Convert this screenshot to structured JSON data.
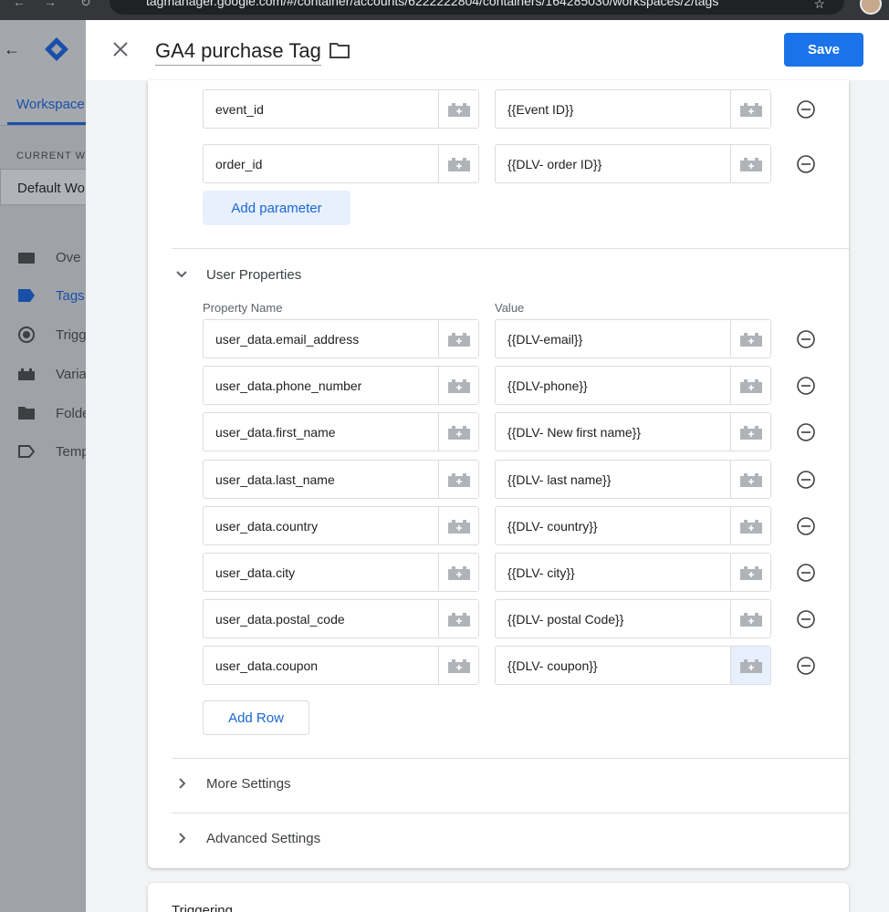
{
  "browser": {
    "url": "tagmanager.google.com/#/container/accounts/6222222804/containers/164285030/workspaces/2/tags"
  },
  "background": {
    "tab_label": "Workspace",
    "current_label": "CURRENT WO",
    "workspace_name": "Default Wo",
    "nav": [
      "Ove",
      "Tags",
      "Trigg",
      "Varia",
      "Folde",
      "Temp"
    ]
  },
  "panel": {
    "title": "GA4 purchase Tag",
    "save_label": "Save"
  },
  "event_params": [
    {
      "name": "event_id",
      "value": "{{Event ID}}"
    },
    {
      "name": "order_id",
      "value": "{{DLV- order ID}}"
    }
  ],
  "add_parameter_label": "Add parameter",
  "user_properties": {
    "title": "User Properties",
    "col_name": "Property Name",
    "col_value": "Value",
    "rows": [
      {
        "name": "user_data.email_address",
        "value": "{{DLV-email}}"
      },
      {
        "name": "user_data.phone_number",
        "value": "{{DLV-phone}}"
      },
      {
        "name": "user_data.first_name",
        "value": "{{DLV- New first name}}"
      },
      {
        "name": "user_data.last_name",
        "value": "{{DLV- last name}}"
      },
      {
        "name": "user_data.country",
        "value": "{{DLV- country}}"
      },
      {
        "name": "user_data.city",
        "value": "{{DLV- city}}"
      },
      {
        "name": "user_data.postal_code",
        "value": "{{DLV- postal Code}}"
      },
      {
        "name": "user_data.coupon",
        "value": "{{DLV- coupon}}"
      }
    ],
    "add_row_label": "Add Row"
  },
  "more_settings_label": "More Settings",
  "advanced_settings_label": "Advanced Settings",
  "triggering_label": "Triggering",
  "colors": {
    "primary": "#1a73e8",
    "link": "#1967d2",
    "chip_bg": "#e8f0fe"
  }
}
